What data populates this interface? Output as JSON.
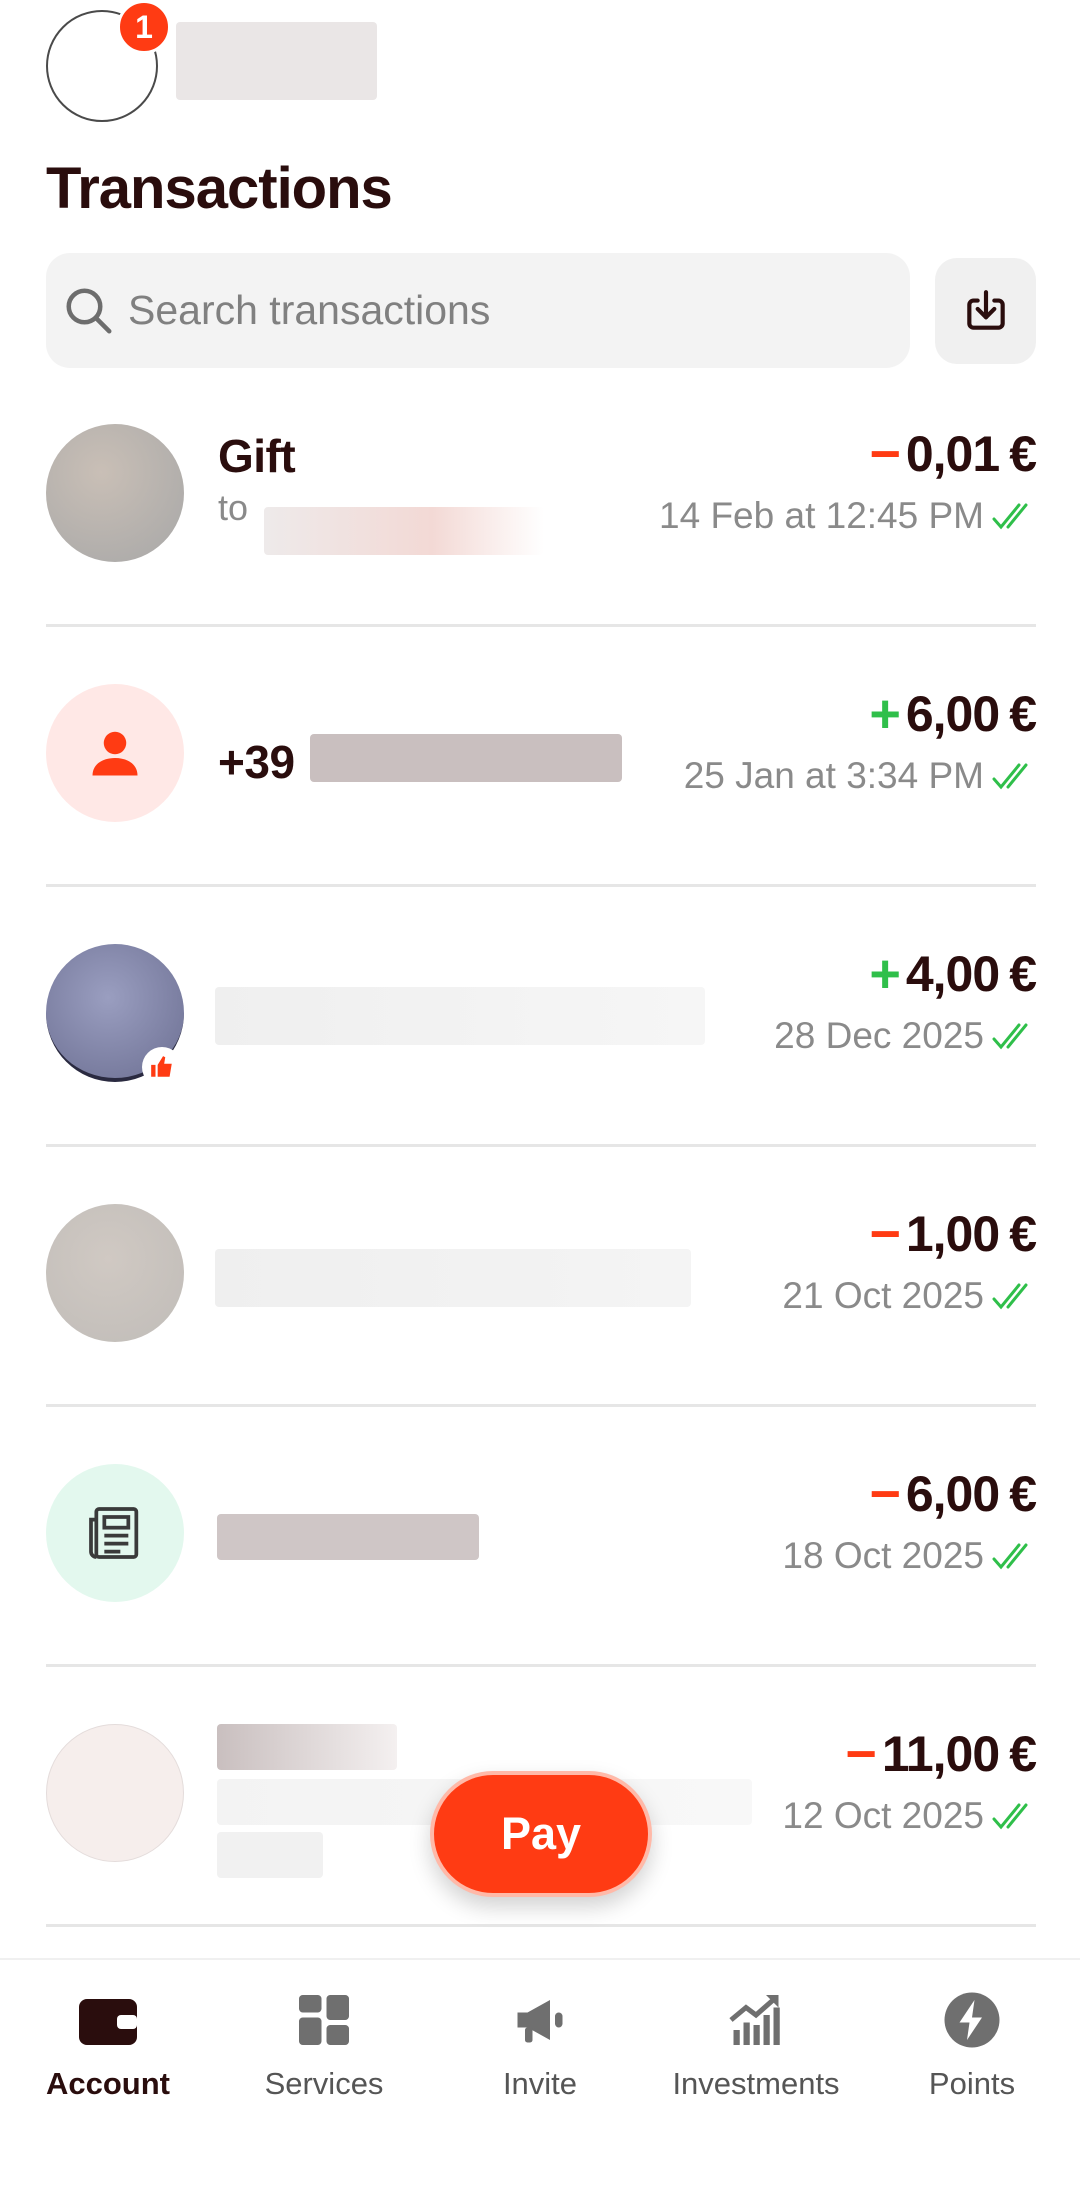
{
  "header": {
    "notification_count": "1",
    "page_title": "Transactions"
  },
  "search": {
    "placeholder": "Search transactions"
  },
  "transactions": [
    {
      "title": "Gift",
      "subtitle": "to",
      "sign": "−",
      "amount": "0,01",
      "currency": "€",
      "direction": "out",
      "date": "14 Feb at 12:45 PM"
    },
    {
      "title": "+39",
      "subtitle": "",
      "sign": "+",
      "amount": "6,00",
      "currency": "€",
      "direction": "in",
      "date": "25 Jan at 3:34 PM"
    },
    {
      "title": "",
      "subtitle": "",
      "sign": "+",
      "amount": "4,00",
      "currency": "€",
      "direction": "in",
      "date": "28 Dec 2025"
    },
    {
      "title": "",
      "subtitle": "",
      "sign": "−",
      "amount": "1,00",
      "currency": "€",
      "direction": "out",
      "date": "21 Oct 2025"
    },
    {
      "title": "",
      "subtitle": "",
      "sign": "−",
      "amount": "6,00",
      "currency": "€",
      "direction": "out",
      "date": "18 Oct 2025"
    },
    {
      "title": "",
      "subtitle": "",
      "sign": "−",
      "amount": "11,00",
      "currency": "€",
      "direction": "out",
      "date": "12 Oct 2025"
    }
  ],
  "pay_button": {
    "label": "Pay"
  },
  "tabbar": {
    "items": [
      {
        "label": "Account",
        "icon": "wallet-icon",
        "active": true
      },
      {
        "label": "Services",
        "icon": "grid-icon",
        "active": false
      },
      {
        "label": "Invite",
        "icon": "megaphone-icon",
        "active": false
      },
      {
        "label": "Investments",
        "icon": "growth-chart-icon",
        "active": false
      },
      {
        "label": "Points",
        "icon": "lightning-icon",
        "active": false
      }
    ]
  },
  "colors": {
    "accent": "#ff3b13",
    "positive": "#2fbf4a",
    "text_dark": "#2a0d0d",
    "text_muted": "#8a8a8a"
  }
}
